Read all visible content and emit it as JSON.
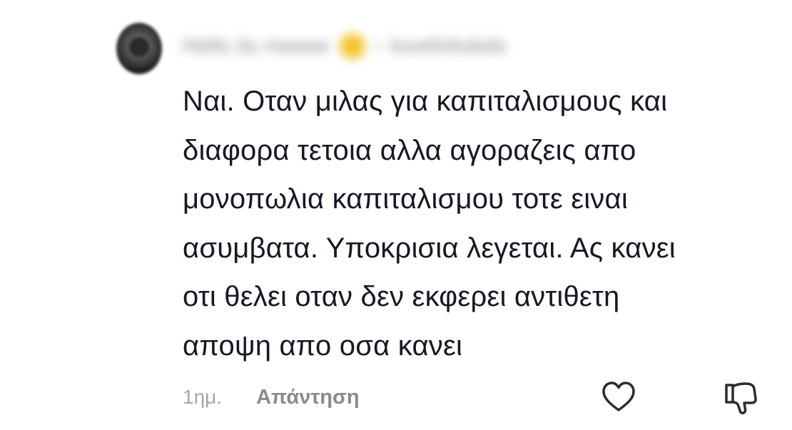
{
  "comment": {
    "author": "Hello its meeee",
    "author_sub": "lovelinkskds",
    "separator": "•",
    "lines": [
      "Ναι. Οταν μιλας για καπιταλισμους και",
      "διαφορα τετοια αλλα αγοραζεις απο",
      "μονοπωλια καπιταλισμου τοτε ειναι",
      "ασυμβατα. Υποκρισια λεγεται. Ας κανει",
      "οτι θελει οταν δεν εκφερει αντιθετη",
      "αποψη απο οσα κανει"
    ],
    "time": "1ημ.",
    "reply_label": "Απάντηση"
  },
  "icons": {
    "like": "heart-outline-icon",
    "dislike": "thumbs-down-outline-icon"
  },
  "colors": {
    "text": "#161823",
    "muted": "#8a8b91",
    "time": "#a5a6ab"
  }
}
